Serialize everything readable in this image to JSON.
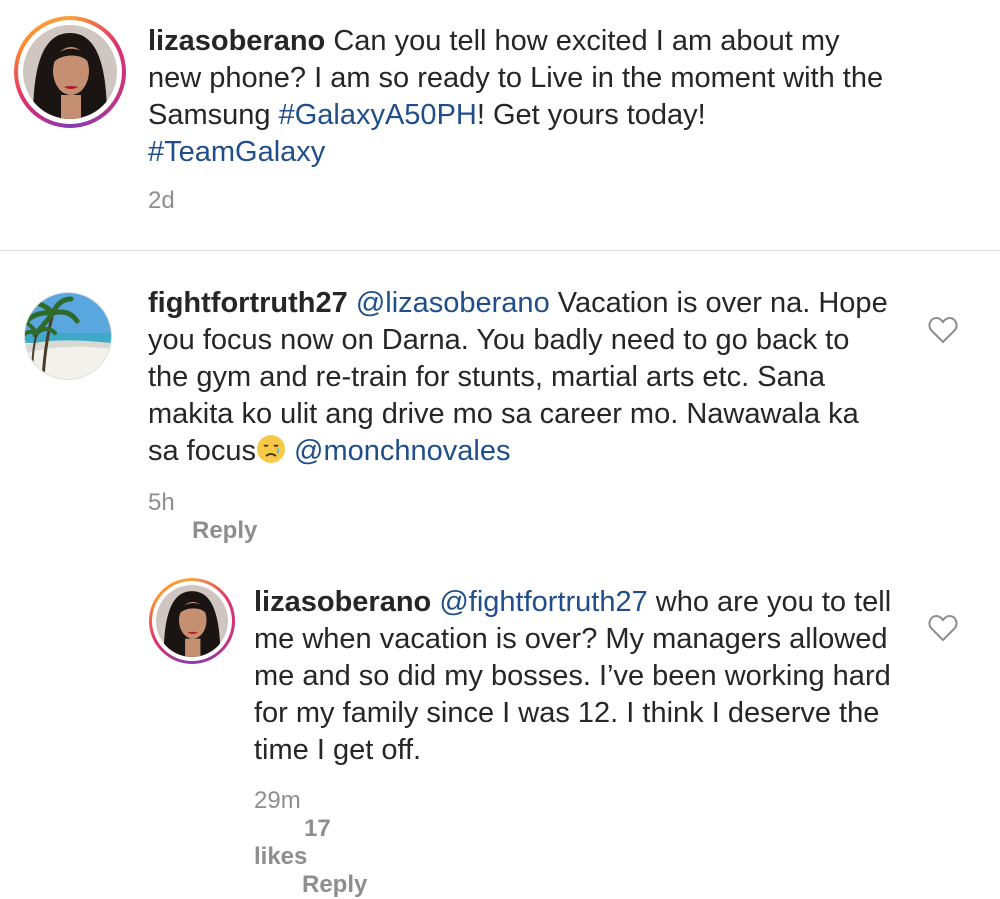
{
  "caption": {
    "username": "lizasoberano",
    "text_before": " Can you tell how excited I am about my new phone? I am so ready to Live in the moment with the Samsung ",
    "hashtag1": "#GalaxyA50PH",
    "text_middle": "! Get yours today! ",
    "hashtag2": "#TeamGalaxy",
    "time": "2d"
  },
  "comment1": {
    "username": "fightfortruth27",
    "mention1": "@lizasoberano",
    "text": " Vacation is over na. Hope you focus now on Darna. You badly need to go back to the gym and re-train for stunts, martial arts etc. Sana makita ko ulit ang drive mo sa career mo. Nawawala ka sa focus",
    "emoji_icon": "sad-face-emoji",
    "mention2": " @monchnovales",
    "time": "5h",
    "reply_label": "Reply"
  },
  "reply1": {
    "username": "lizasoberano",
    "mention": "@fightfortruth27",
    "text": " who are you to tell me when vacation is over? My managers allowed me and so did my bosses. I’ve been working hard for my family since I was 12. I think I deserve the time I get off.",
    "time": "29m",
    "likes": "17 likes",
    "reply_label": "Reply"
  },
  "colors": {
    "hashtag": "#1f4e8a",
    "meta": "#8e8e8e",
    "divider": "#dbdbdb"
  }
}
